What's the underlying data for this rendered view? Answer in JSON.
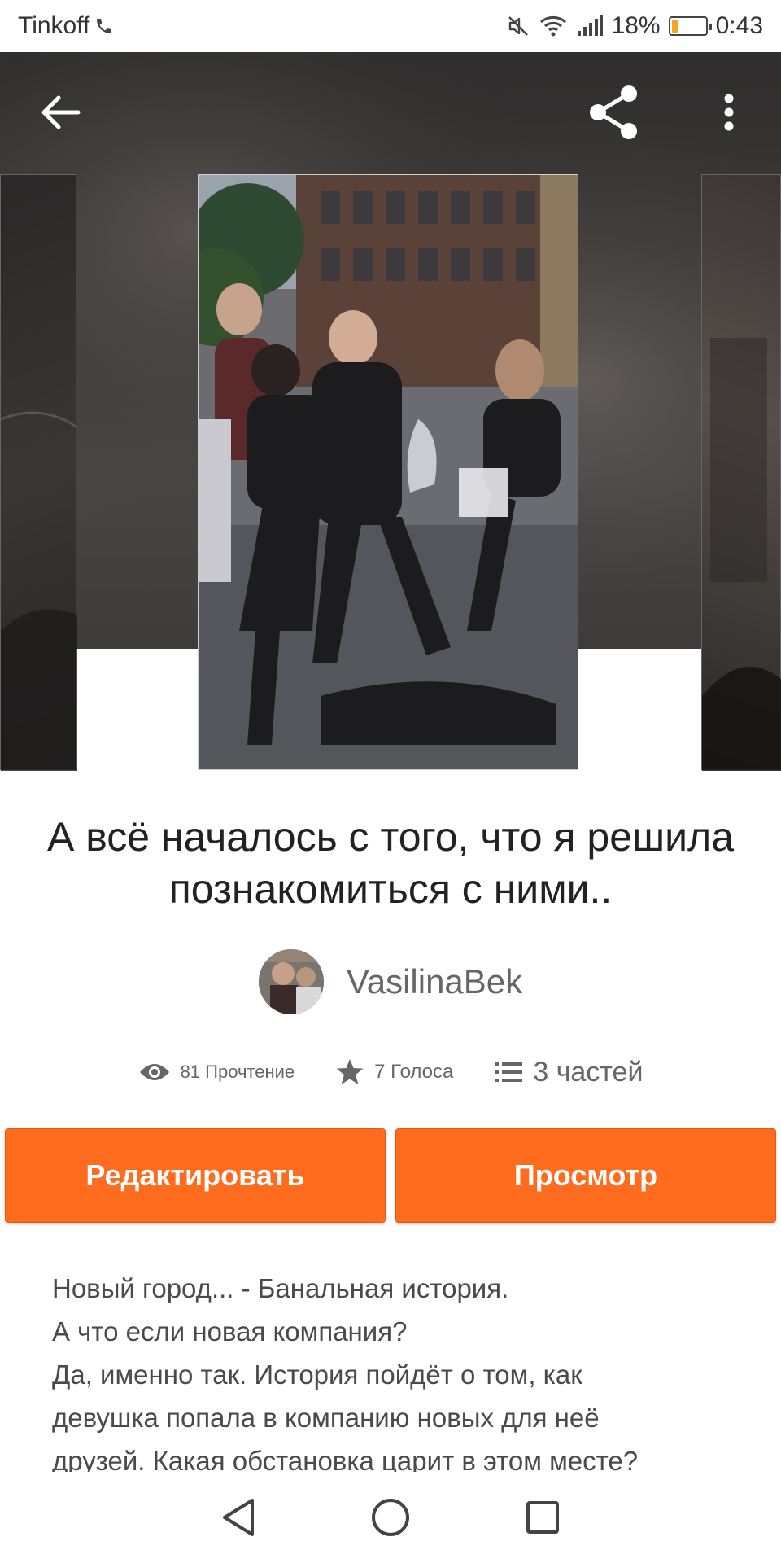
{
  "status_bar": {
    "carrier": "Tinkoff",
    "battery_percent": "18%",
    "battery_level": 0.18,
    "time": "0:43",
    "icons": [
      "phone-icon",
      "mute-icon",
      "wifi-icon",
      "signal-icon",
      "battery-icon"
    ]
  },
  "toolbar": {
    "icons": [
      "back-arrow-icon",
      "share-icon",
      "more-vertical-icon"
    ]
  },
  "story": {
    "title": "А всё началось с того, что я решила познакомиться с ними..",
    "author": "VasilinaBek",
    "reads": "81 Прочтение",
    "votes": "7 Голоса",
    "parts": "3 частей"
  },
  "actions": {
    "edit_label": "Редактировать",
    "view_label": "Просмотр"
  },
  "description": {
    "lines": [
      "Новый город... - Банальная история.",
      "А что если новая компания?",
      "Да, именно так. История пойдёт о том, как",
      "девушка попала в компанию новых для неё",
      "друзей. Какая обстановка царит в этом месте?"
    ]
  },
  "colors": {
    "accent": "#ff6c1e",
    "header_bg": "#3d3a39"
  },
  "nav_bar": {
    "icons": [
      "back-triangle-icon",
      "home-circle-icon",
      "recents-square-icon"
    ]
  }
}
